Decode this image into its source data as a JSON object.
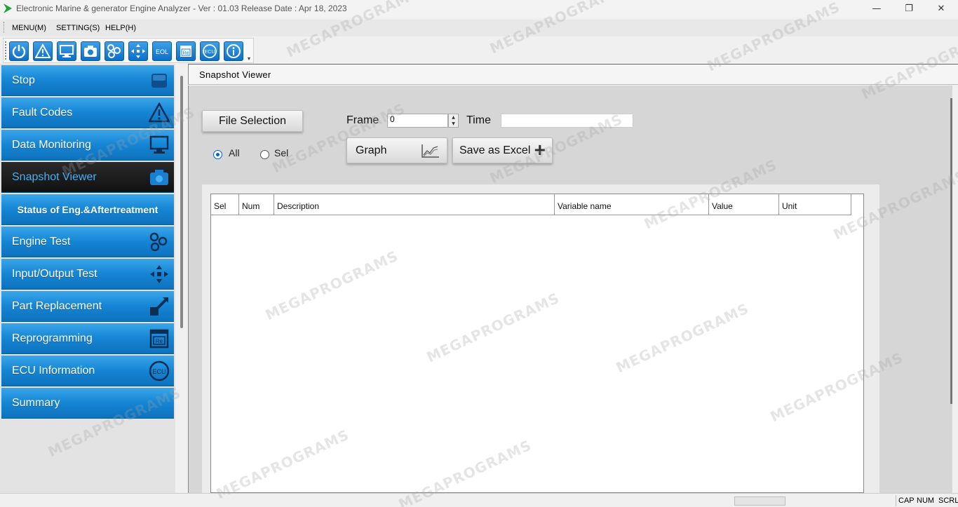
{
  "window": {
    "title": "Electronic Marine & generator Engine Analyzer - Ver : 01.03 Release Date : Apr 18, 2023",
    "minimize": "—",
    "maximize": "❐",
    "close": "✕"
  },
  "menubar": {
    "items": [
      "MENU(M)",
      "SETTING(S)",
      "HELP(H)"
    ]
  },
  "toolbar": {
    "buttons": [
      {
        "icon": "power-icon"
      },
      {
        "icon": "warning-icon"
      },
      {
        "icon": "monitor-icon"
      },
      {
        "icon": "camera-icon"
      },
      {
        "icon": "engine-test-icon"
      },
      {
        "icon": "io-arrows-icon"
      },
      {
        "icon": "eol-icon",
        "text": "EOL"
      },
      {
        "icon": "reprogram-icon",
        "text": "Re"
      },
      {
        "icon": "ecu-icon",
        "text": "ECU"
      },
      {
        "icon": "info-icon"
      }
    ]
  },
  "sidebar": {
    "items": [
      {
        "label": "Stop",
        "icon": "stop-icon"
      },
      {
        "label": "Fault Codes",
        "icon": "warning-icon"
      },
      {
        "label": "Data Monitoring",
        "icon": "monitor-icon"
      },
      {
        "label": "Snapshot Viewer",
        "icon": "camera-icon",
        "active": true
      },
      {
        "label": "Status of Eng.&Aftertreatment"
      },
      {
        "label": "Engine Test",
        "icon": "engine-test-icon"
      },
      {
        "label": "Input/Output Test",
        "icon": "io-arrows-icon"
      },
      {
        "label": "Part Replacement",
        "icon": "part-replace-icon"
      },
      {
        "label": "Reprogramming",
        "icon": "reprogram-icon",
        "icon_text": "Re"
      },
      {
        "label": "ECU Information",
        "icon": "ecu-icon",
        "icon_text": "ECU"
      },
      {
        "label": "Summary"
      }
    ],
    "accent": "#1585d4",
    "active_text_color": "#48b2f5"
  },
  "main": {
    "title": "Snapshot Viewer",
    "file_selection": "File Selection",
    "frame_label": "Frame",
    "frame_value": "0",
    "time_label": "Time",
    "time_value": "",
    "radio_all": "All",
    "radio_sel": "Sel",
    "graph_label": "Graph",
    "excel_label": "Save as Excel",
    "table": {
      "columns": [
        "Sel",
        "Num",
        "Description",
        "Variable name",
        "Value",
        "Unit"
      ],
      "rows": []
    }
  },
  "statusbar": {
    "cap": "CAP",
    "num": "NUM",
    "scrl": "SCRL"
  },
  "watermark": "MEGAPROGRAMS"
}
